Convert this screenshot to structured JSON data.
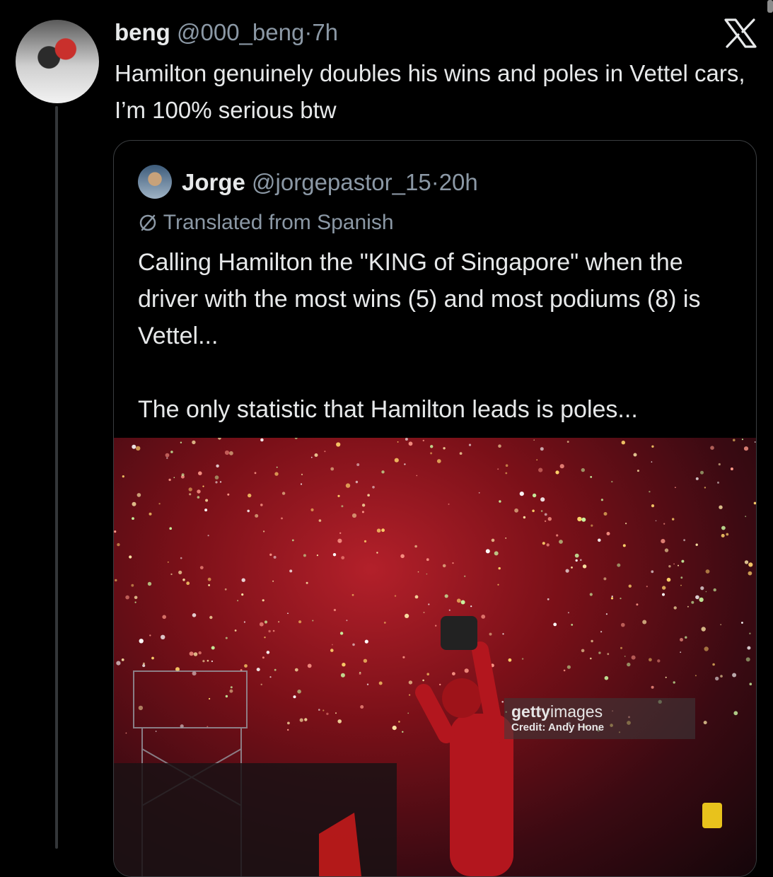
{
  "tweet": {
    "author_name": "beng",
    "author_handle": "@000_beng",
    "time": "7h",
    "separator": "·",
    "text": "Hamilton genuinely doubles his wins and poles in Vettel cars, I’m 100% serious btw",
    "avatar_icon": "user-avatar"
  },
  "quoted": {
    "author_name": "Jorge",
    "author_handle": "@jorgepastor_15",
    "time": "20h",
    "separator": "·",
    "translated_label": "Translated from Spanish",
    "paragraph_1": "Calling Hamilton the \"KING of Singapore\" when the driver with the most wins (5) and most podiums (8) is Vettel...",
    "paragraph_2": "The only statistic that Hamilton leads is poles..."
  },
  "photo": {
    "getty_logo_bold": "getty",
    "getty_logo_light": "images",
    "credit": "Credit: Andy Hone"
  },
  "colors": {
    "background": "#000000",
    "text_primary": "#e7e9ea",
    "text_secondary": "#8b98a5",
    "border": "#3a3d40"
  }
}
